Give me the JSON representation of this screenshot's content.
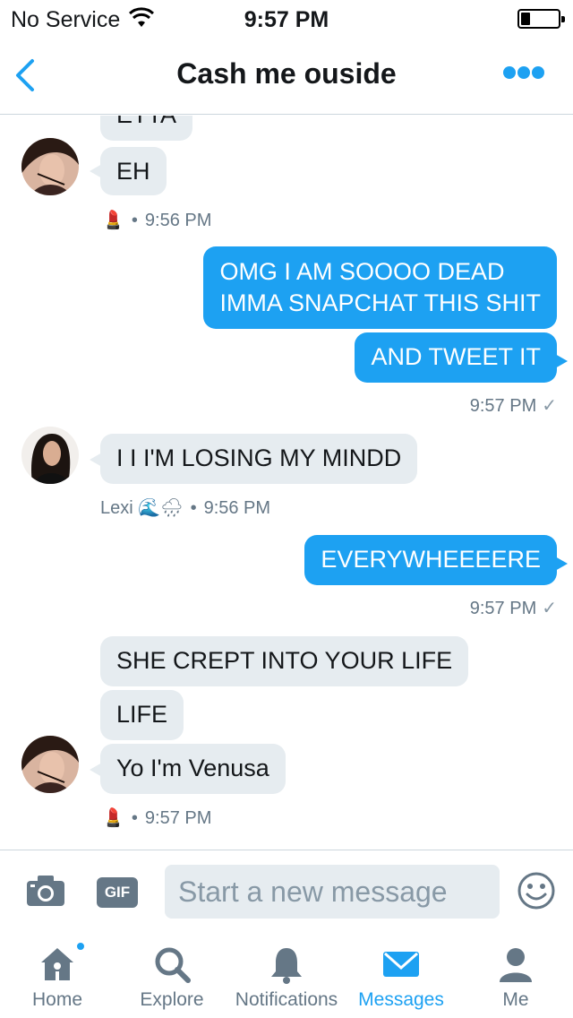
{
  "status": {
    "carrier": "No Service",
    "time": "9:57 PM"
  },
  "nav": {
    "title": "Cash me ouside"
  },
  "messages": {
    "m0": {
      "text": "ETTA"
    },
    "m1": {
      "text": "EH"
    },
    "m1_meta": {
      "emoji": "💄",
      "time": "9:56 PM"
    },
    "m2": {
      "text1": "OMG I AM SOOOO DEAD",
      "text2": "IMMA SNAPCHAT THIS SHIT"
    },
    "m3": {
      "text": "AND TWEET IT"
    },
    "m3_meta": {
      "time": "9:57 PM",
      "check": "✓"
    },
    "m4": {
      "text": "I I I'M LOSING MY MINDD"
    },
    "m4_meta": {
      "sender": "Lexi",
      "emoji": "🌊🌧",
      "time": "9:56 PM"
    },
    "m5": {
      "text": "EVERYWHEEEERE"
    },
    "m5_meta": {
      "time": "9:57 PM",
      "check": "✓"
    },
    "m6": {
      "text": "SHE CREPT INTO YOUR LIFE"
    },
    "m7": {
      "text": "LIFE"
    },
    "m8": {
      "text": "Yo I'm Venusa"
    },
    "m8_meta": {
      "emoji": "💄",
      "time": "9:57 PM"
    }
  },
  "composer": {
    "gif_label": "GIF",
    "placeholder": "Start a new message"
  },
  "tabs": {
    "home": "Home",
    "explore": "Explore",
    "notifications": "Notifications",
    "messages": "Messages",
    "me": "Me"
  },
  "colors": {
    "accent": "#1da1f2",
    "bubble_in": "#e6ecf0",
    "muted": "#657786"
  },
  "icons": {
    "back": "chevron-left-icon",
    "more": "more-dots-icon",
    "camera": "camera-icon",
    "emoji": "smiley-icon",
    "home": "home-icon",
    "explore": "search-icon",
    "notifications": "bell-icon",
    "messages": "envelope-icon",
    "me": "person-icon"
  }
}
